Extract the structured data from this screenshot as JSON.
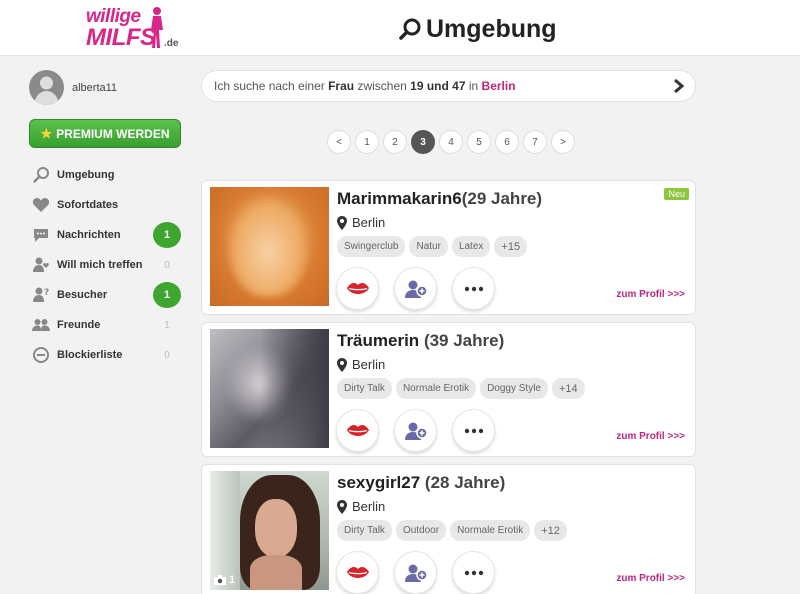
{
  "header": {
    "logo_line1": "willige",
    "logo_line2": "MILFS",
    "logo_tld": ".de",
    "title": "Umgebung"
  },
  "profile": {
    "username": "alberta11"
  },
  "premium_label": "PREMIUM WERDEN",
  "nav": [
    {
      "label": "Umgebung",
      "icon": "search-icon",
      "count": ""
    },
    {
      "label": "Sofortdates",
      "icon": "heart-icon",
      "count": ""
    },
    {
      "label": "Nachrichten",
      "icon": "chat-icon",
      "count": "1",
      "badge": true
    },
    {
      "label": "Will mich treffen",
      "icon": "user-heart-icon",
      "count": "0"
    },
    {
      "label": "Besucher",
      "icon": "user-question-icon",
      "count": "1",
      "badge": true
    },
    {
      "label": "Freunde",
      "icon": "friends-icon",
      "count": "1"
    },
    {
      "label": "Blockierliste",
      "icon": "block-icon",
      "count": "0"
    }
  ],
  "search": {
    "prefix": "Ich suche nach einer",
    "gender": "Frau",
    "between": "zwischen",
    "range": "19 und 47",
    "in": "in",
    "city": "Berlin"
  },
  "pagination": [
    "<",
    "1",
    "2",
    "3",
    "4",
    "5",
    "6",
    "7",
    ">"
  ],
  "current_page": "3",
  "profile_link_label": "zum Profil >>>",
  "profiles": [
    {
      "name": "Marimmakarin6",
      "age": "(29 Jahre)",
      "city": "Berlin",
      "tags": [
        "Swingerclub",
        "Natur",
        "Latex",
        "+15"
      ],
      "badge": "Neu",
      "photo_count": ""
    },
    {
      "name": "Träumerin",
      "age": "(39 Jahre)",
      "city": "Berlin",
      "tags": [
        "Dirty Talk",
        "Normale Erotik",
        "Doggy Style",
        "+14"
      ],
      "badge": "",
      "photo_count": ""
    },
    {
      "name": "sexygirl27",
      "age": "(28 Jahre)",
      "city": "Berlin",
      "tags": [
        "Dirty Talk",
        "Outdoor",
        "Normale Erotik",
        "+12"
      ],
      "badge": "",
      "photo_count": "1"
    }
  ],
  "colors": {
    "accent": "#c0267f",
    "green": "#3ea52f",
    "new_badge": "#8dc63f"
  }
}
